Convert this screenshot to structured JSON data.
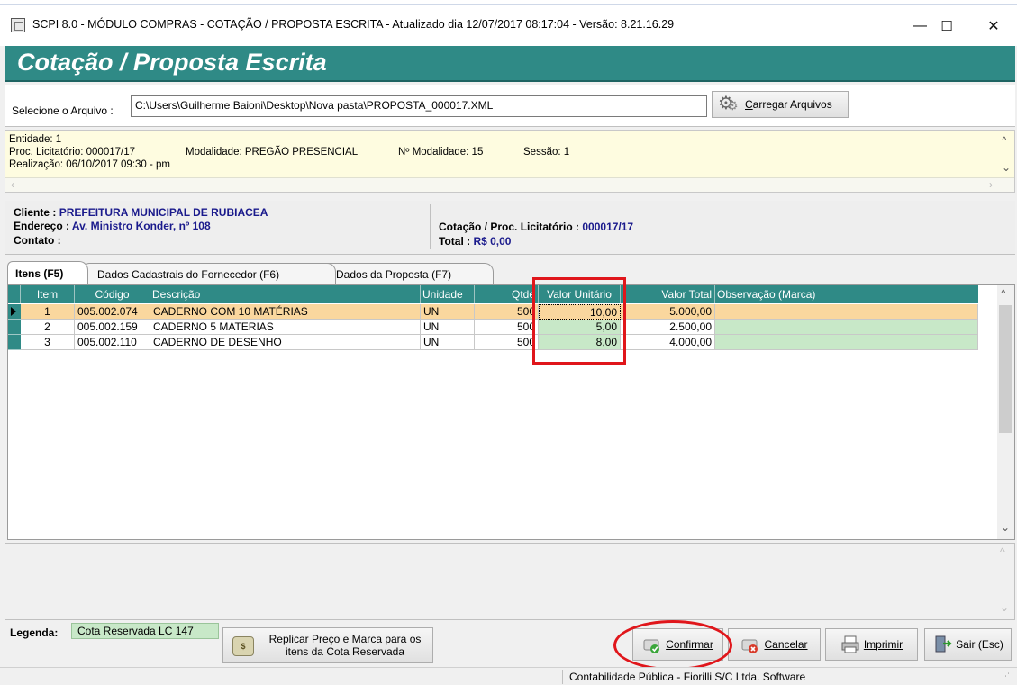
{
  "window": {
    "title": "SCPI 8.0 - MÓDULO COMPRAS - COTAÇÃO / PROPOSTA ESCRITA - Atualizado dia 12/07/2017 08:17:04 - Versão: 8.21.16.29",
    "minimize": "—",
    "maximize": "☐",
    "close": "✕"
  },
  "banner": {
    "title": "Cotação / Proposta Escrita"
  },
  "file": {
    "label": "Selecione o Arquivo :",
    "path": "C:\\Users\\Guilherme Baioni\\Desktop\\Nova pasta\\PROPOSTA_000017.XML",
    "load_button": "Carregar Arquivos",
    "load_button_accel": "C",
    "load_button_rest": "arregar Arquivos"
  },
  "info": {
    "entidade": "Entidade: 1",
    "proc": "Proc. Licitatório: 000017/17",
    "modalidade": "Modalidade: PREGÃO PRESENCIAL",
    "num_modalidade": "Nº Modalidade: 15",
    "sessao": "Sessão: 1",
    "realizacao": "Realização: 06/10/2017 09:30 - pm"
  },
  "client": {
    "cliente_label": "Cliente :",
    "cliente_value": "PREFEITURA MUNICIPAL DE RUBIACEA",
    "endereco_label": "Endereço :",
    "endereco_value": "Av. Ministro Konder, nº 108",
    "contato_label": "Contato :",
    "cotacao_label": "Cotação / Proc. Licitatório :",
    "cotacao_value": "000017/17",
    "total_label": "Total :",
    "total_value": "R$ 0,00"
  },
  "tabs": [
    {
      "label": "Itens (F5)",
      "active": true
    },
    {
      "label": "Dados Cadastrais do Fornecedor (F6)",
      "active": false
    },
    {
      "label": "Dados da Proposta (F7)",
      "active": false
    }
  ],
  "grid": {
    "columns": [
      "Item",
      "Código",
      "Descrição",
      "Unidade",
      "Qtde",
      "Valor Unitário",
      "Valor Total",
      "Observação (Marca)"
    ],
    "rows": [
      {
        "item": "1",
        "codigo": "005.002.074",
        "descricao": "CADERNO COM 10 MATÉRIAS",
        "unidade": "UN",
        "qtde": "500",
        "valor_unitario": "10,00",
        "valor_total": "5.000,00",
        "obs": ""
      },
      {
        "item": "2",
        "codigo": "005.002.159",
        "descricao": "CADERNO 5 MATERIAS",
        "unidade": "UN",
        "qtde": "500",
        "valor_unitario": "5,00",
        "valor_total": "2.500,00",
        "obs": ""
      },
      {
        "item": "3",
        "codigo": "005.002.110",
        "descricao": "CADERNO DE DESENHO",
        "unidade": "UN",
        "qtde": "500",
        "valor_unitario": "8,00",
        "valor_total": "4.000,00",
        "obs": ""
      }
    ]
  },
  "legend": {
    "label": "Legenda:",
    "badge": "Cota Reservada LC 147"
  },
  "buttons": {
    "replicar_line1": "Replicar Preço e Marca para os",
    "replicar_line2": "itens da Cota Reservada",
    "confirmar": "Confirmar",
    "cancelar": "Cancelar",
    "imprimir": "Imprimir",
    "sair": "Sair (Esc)"
  },
  "status": {
    "text": "Contabilidade Pública - Fiorilli S/C Ltda. Software"
  },
  "colors": {
    "accent": "#2f8a86",
    "selected_row": "#fad79e",
    "reserved": "#c8e8c8",
    "highlight_red": "#e0161b"
  }
}
